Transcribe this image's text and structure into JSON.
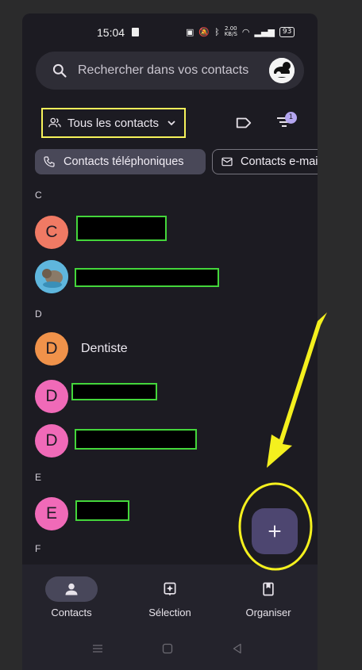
{
  "status_bar": {
    "time": "15:04",
    "network_speed": "2.00\nKB/S",
    "battery": "93"
  },
  "search": {
    "placeholder": "Rechercher dans vos contacts"
  },
  "filter": {
    "selected": "Tous les contacts",
    "sort_badge_count": "1"
  },
  "chips": [
    {
      "label": "Contacts téléphoniques",
      "selected": true
    },
    {
      "label": "Contacts e-mail",
      "selected": false
    }
  ],
  "contacts": {
    "sections": [
      "C",
      "D",
      "E",
      "F"
    ],
    "items": [
      {
        "section": "C",
        "initial": "C",
        "name": "",
        "avatar_color": "#f07a64",
        "redacted": true
      },
      {
        "section": "C",
        "initial": "",
        "name": "",
        "avatar_color": "#2fa8d8",
        "photo": true,
        "redacted": true
      },
      {
        "section": "D",
        "initial": "D",
        "name": "Dentiste",
        "avatar_color": "#f0924a",
        "redacted": false
      },
      {
        "section": "D",
        "initial": "D",
        "name": "",
        "avatar_color": "#f06ab8",
        "redacted": true
      },
      {
        "section": "D",
        "initial": "D",
        "name": "",
        "avatar_color": "#f06ab8",
        "redacted": true
      },
      {
        "section": "E",
        "initial": "E",
        "name": "",
        "avatar_color": "#f06ab8",
        "redacted": true
      }
    ]
  },
  "fab": {
    "icon": "plus-icon"
  },
  "bottom_nav": [
    {
      "label": "Contacts",
      "icon": "person-icon",
      "active": true
    },
    {
      "label": "Sélection",
      "icon": "sparkle-icon",
      "active": false
    },
    {
      "label": "Organiser",
      "icon": "bookmark-icon",
      "active": false
    }
  ],
  "colors": {
    "highlight_box": "#f7f35a",
    "redaction_border": "#44d63b",
    "arrow": "#f4f01e"
  }
}
